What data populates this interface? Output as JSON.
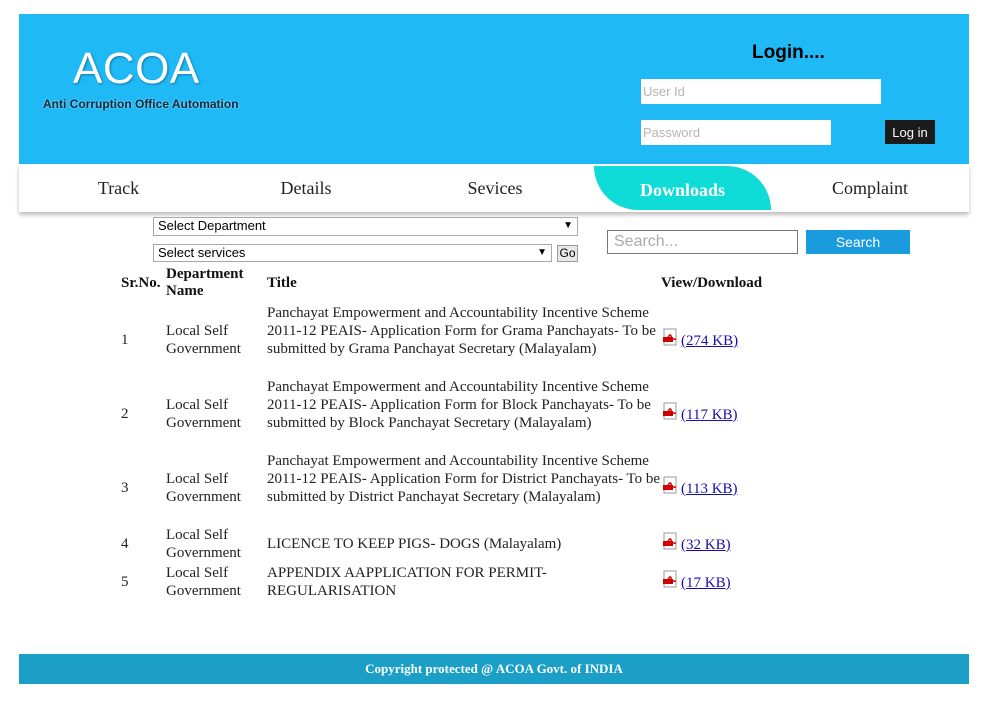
{
  "header": {
    "logo_title": "ACOA",
    "logo_subtitle": "Anti Corruption Office Automation",
    "login_title": "Login....",
    "userid_placeholder": "User Id",
    "password_placeholder": "Password",
    "login_button": "Log in"
  },
  "nav": {
    "items": [
      "Track",
      "Details",
      "Sevices",
      "Downloads",
      "Complaint"
    ],
    "active": "Downloads"
  },
  "filters": {
    "department_select": "Select Department",
    "services_select": "Select services",
    "go_button": "Go",
    "search_placeholder": "Search...",
    "search_button": "Search"
  },
  "table": {
    "headers": [
      "Sr.No.",
      "Department Name",
      "Title",
      "View/Download"
    ],
    "rows": [
      {
        "sr": "1",
        "department": "Local Self Government",
        "title": "Panchayat Empowerment and Accountability Incentive Scheme 2011-12 PEAIS- Application Form for Grama Panchayats- To be submitted by Grama Panchayat Secretary (Malayalam)",
        "download": "(274 KB)"
      },
      {
        "sr": "2",
        "department": "Local Self Government",
        "title": "Panchayat Empowerment and Accountability Incentive Scheme 2011-12 PEAIS- Application Form for Block Panchayats- To be submitted by Block Panchayat Secretary (Malayalam)",
        "download": "(117 KB)"
      },
      {
        "sr": "3",
        "department": "Local Self Government",
        "title": "Panchayat Empowerment and Accountability Incentive Scheme 2011-12 PEAIS- Application Form for District Panchayats- To be submitted by District Panchayat Secretary (Malayalam)",
        "download": "(113 KB)"
      },
      {
        "sr": "4",
        "department": "Local Self Government",
        "title": "LICENCE TO KEEP PIGS- DOGS (Malayalam)",
        "download": "(32 KB)"
      },
      {
        "sr": "5",
        "department": "Local Self Government",
        "title": "APPENDIX AAPPLICATION FOR PERMIT-REGULARISATION",
        "download": "(17 KB)"
      }
    ]
  },
  "footer": {
    "text": "Copyright protected @ ACOA Govt. of INDIA"
  },
  "colors": {
    "header_bg": "#1fb9f6",
    "active_tab": "#0fdcd6",
    "search_button": "#1a9bde",
    "footer_bg": "#1b9fc7"
  },
  "icons": {
    "download": "pdf-icon"
  }
}
